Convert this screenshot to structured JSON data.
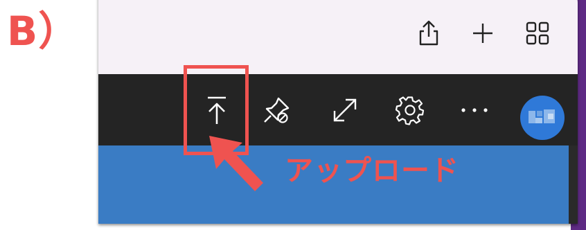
{
  "annotation": {
    "step_label": "B）",
    "callout_text": "アップロード",
    "accent_color": "#ef5350"
  },
  "browser_toolbar": {
    "icons": [
      "share-icon",
      "new-tab-plus-icon",
      "tab-grid-icon"
    ]
  },
  "app_toolbar": {
    "background": "#242424",
    "icons": [
      "upload-icon",
      "unpin-icon",
      "expand-icon",
      "gear-icon",
      "more-icon"
    ],
    "avatar_color": "#2f79d8"
  },
  "content": {
    "background": "#3a7cc4"
  }
}
